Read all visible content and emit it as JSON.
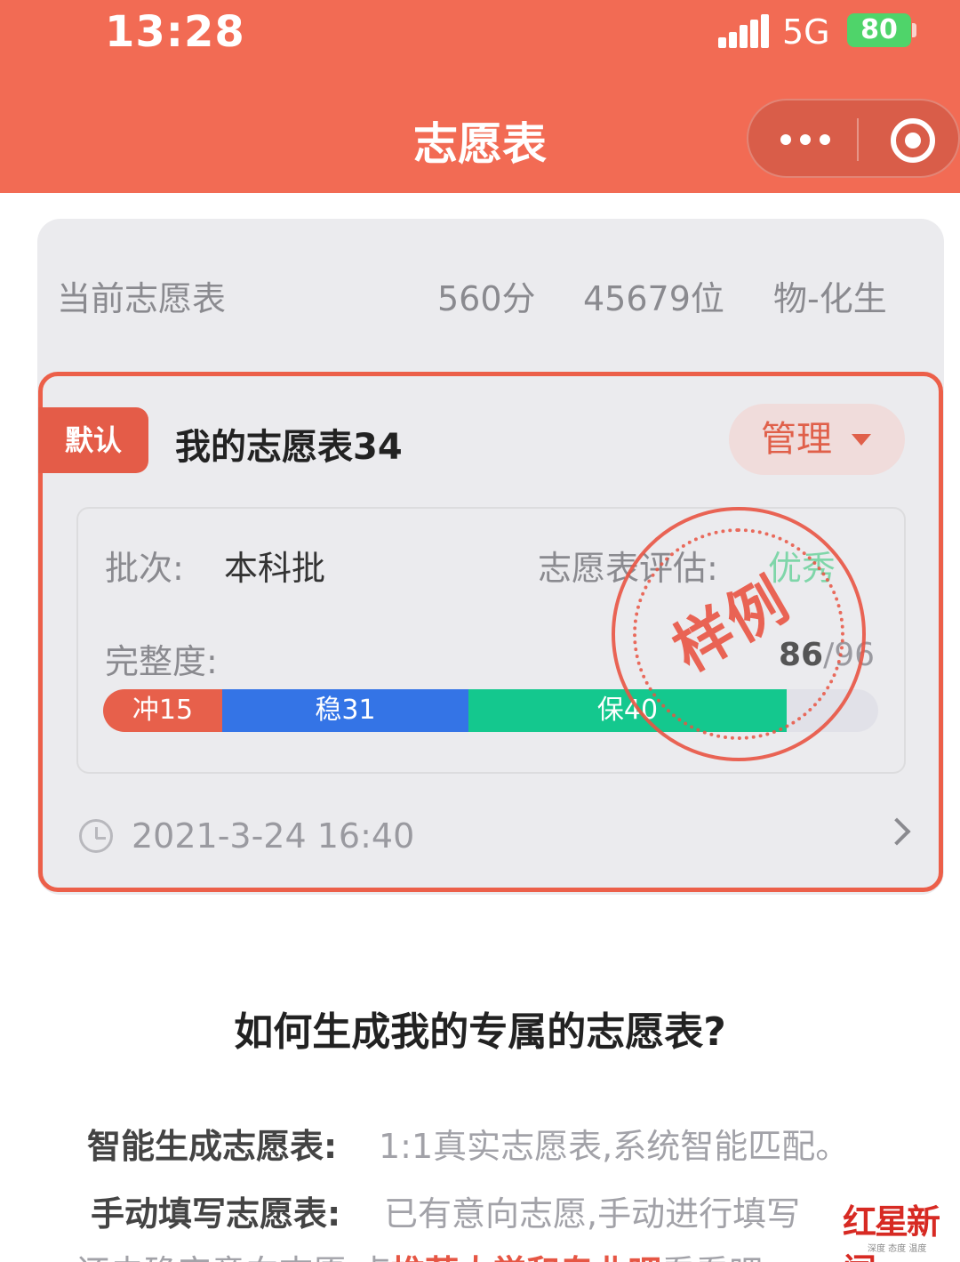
{
  "status_bar": {
    "time": "13:28",
    "network": "5G",
    "battery": "80"
  },
  "nav": {
    "title": "志愿表"
  },
  "current": {
    "label": "当前志愿表",
    "score": "560分",
    "rank": "45679位",
    "subjects": "物-化生"
  },
  "form_card": {
    "default_tag": "默认",
    "name": "我的志愿表34",
    "manage_label": "管理",
    "batch_label": "批次:",
    "batch_value": "本科批",
    "eval_label": "志愿表评估:",
    "eval_value": "优秀",
    "completeness_label": "完整度:",
    "completeness_done": "86",
    "completeness_total": "/96",
    "completeness_ratio": 0.896,
    "segments": [
      {
        "label": "冲15",
        "count": 15,
        "color": "#e7604b"
      },
      {
        "label": "稳31",
        "count": 31,
        "color": "#3474e6"
      },
      {
        "label": "保40",
        "count": 40,
        "color": "#14c88e"
      }
    ],
    "stamp": "样例",
    "datetime": "2021-3-24  16:40"
  },
  "howto": {
    "title": "如何生成我的专属的志愿表?",
    "smart_label": "智能生成志愿表:",
    "smart_text": "1:1真实志愿表,系统智能匹配。",
    "manual_label": "手动填写志愿表:",
    "manual_text": "已有意向志愿,手动进行填写",
    "line3_prefix": "还未确定意向志愿,点",
    "line3_link": "推荐大学和专业吧",
    "line3_suffix": "看看吧"
  },
  "watermark": {
    "main": "红星新闻",
    "sub": "深度 态度 温度"
  },
  "colors": {
    "brand": "#f26b54",
    "accent_red": "#e45c48",
    "success_green": "#7fd6a9"
  }
}
